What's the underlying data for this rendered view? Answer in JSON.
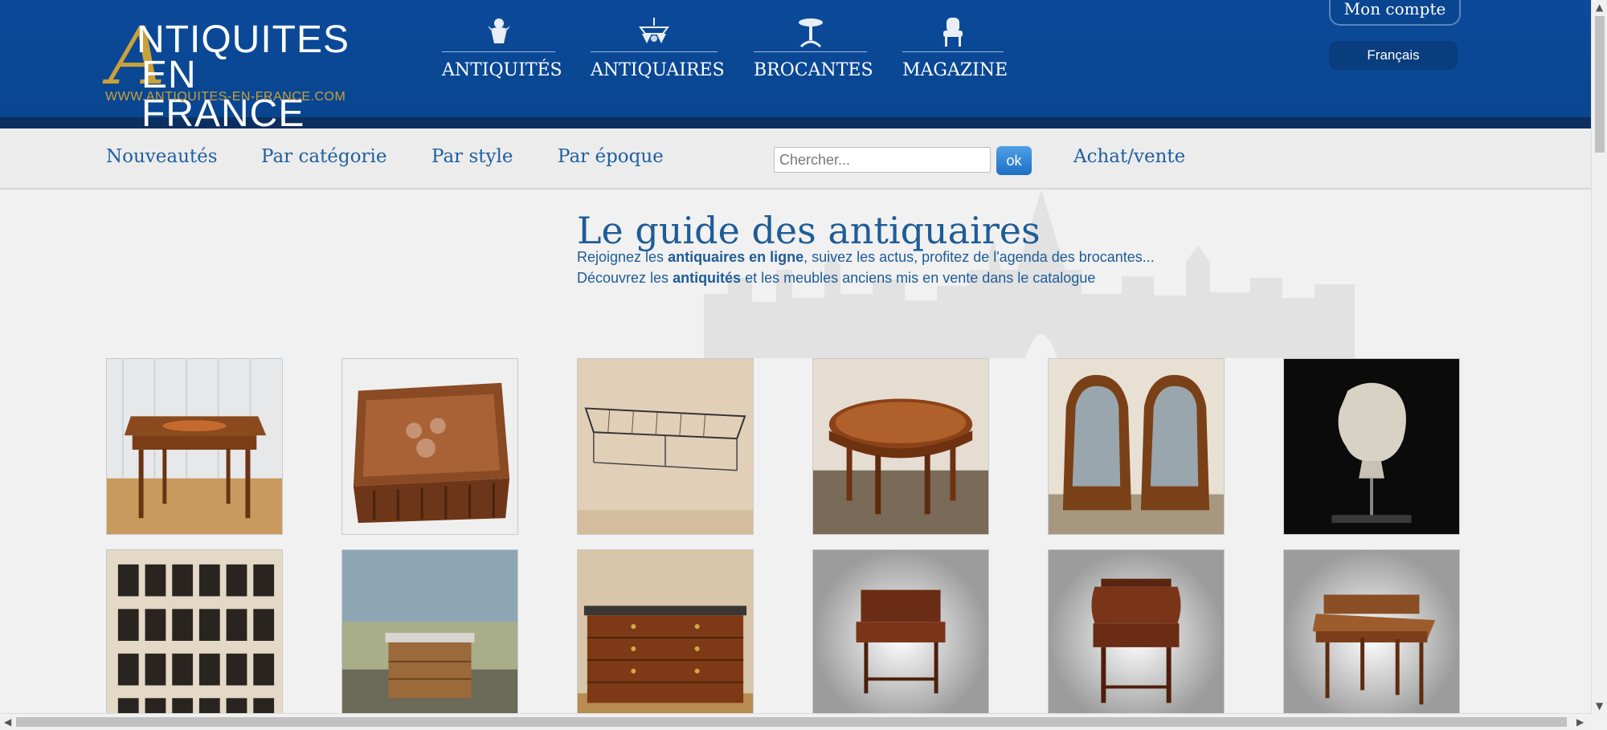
{
  "header": {
    "logo": {
      "line1": "NTIQUITES",
      "line2": "EN FRANCE",
      "initial": "A",
      "url": "WWW.ANTIQUITES-EN-FRANCE.COM"
    },
    "nav": [
      {
        "label": "ANTIQUITÉS",
        "icon": "cherub-icon"
      },
      {
        "label": "ANTIQUAIRES",
        "icon": "chandelier-icon"
      },
      {
        "label": "BROCANTES",
        "icon": "pedestal-table-icon"
      },
      {
        "label": "MAGAZINE",
        "icon": "armchair-icon"
      }
    ],
    "account_label": "Mon compte",
    "language_label": "Français"
  },
  "subnav": {
    "links": [
      "Nouveautés",
      "Par catégorie",
      "Par style",
      "Par époque"
    ],
    "search_placeholder": "Chercher...",
    "search_button": "ok",
    "buy_sell": "Achat/vente"
  },
  "guide": {
    "title": "Le guide des antiquaires",
    "line1_pre": "Rejoignez les ",
    "line1_bold": "antiquaires en ligne",
    "line1_post": ", suivez les actus, profitez de l'agenda des brocantes...",
    "line2_pre": "Découvrez les ",
    "line2_bold": "antiquités",
    "line2_post": " et les meubles anciens mis en vente dans le catalogue"
  },
  "products": [
    {
      "name": "marquetry-side-table"
    },
    {
      "name": "carved-wooden-box"
    },
    {
      "name": "metal-wall-rack"
    },
    {
      "name": "round-inlaid-table"
    },
    {
      "name": "pair-of-armchairs"
    },
    {
      "name": "plaster-bust"
    },
    {
      "name": "framed-herbarium"
    },
    {
      "name": "marble-top-commode"
    },
    {
      "name": "empire-chest-of-drawers"
    },
    {
      "name": "writing-desk"
    },
    {
      "name": "roll-top-secretary"
    },
    {
      "name": "ladies-desk"
    }
  ],
  "colors": {
    "header": "#0b4a9a",
    "gold": "#c9a13a",
    "link": "#1f5f9f"
  }
}
